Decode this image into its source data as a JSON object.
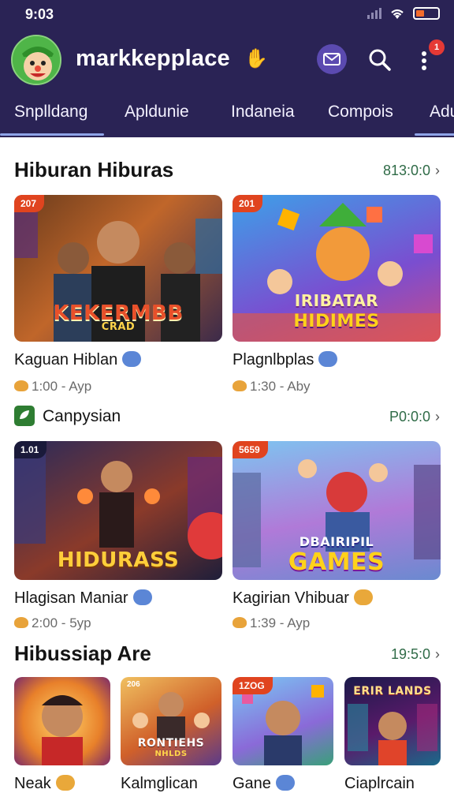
{
  "status": {
    "time": "9:03"
  },
  "app": {
    "title": "markkepplace",
    "notification_count": "1"
  },
  "tabs": [
    "Snplldang",
    "Apldunie",
    "Indaneia",
    "Compois",
    "Adu"
  ],
  "sections": [
    {
      "title": "Hiburan Hiburas",
      "link": "813:0:0",
      "cards": [
        {
          "tag": "207",
          "art_title": "KEKERMBB",
          "art_sub": "CRAD",
          "name": "Kaguan Hiblan",
          "badge": "blue",
          "meta": "1:00 - Ayp"
        },
        {
          "tag": "201",
          "art_title": "IRIBATAR",
          "art_sub": "HIDIMES",
          "name": "Plagnlbplas",
          "badge": "blue",
          "meta": "1:30 - Aby"
        }
      ]
    },
    {
      "title": "Canpysian",
      "link": "P0:0:0",
      "cards": [
        {
          "tag": "1.01",
          "art_title": "HIDURASS",
          "art_sub": "",
          "name": "Hlagisan Maniar",
          "badge": "blue",
          "meta": "2:00 - 5yp"
        },
        {
          "tag": "5659",
          "art_title": "DBAIRIPIL",
          "art_sub": "GAMES",
          "name": "Kagirian Vhibuar",
          "badge": "gold",
          "meta": "1:39 - Ayp"
        }
      ]
    },
    {
      "title": "Hibussiap Are",
      "link": "19:5:0",
      "cards": [
        {
          "tag": "",
          "art_title": "",
          "art_sub": "",
          "name": "Neak",
          "badge": "gold"
        },
        {
          "tag": "206",
          "art_title": "RONTIEHS",
          "art_sub": "NHLDS",
          "name": "Kalmglican",
          "badge": ""
        },
        {
          "tag": "1ZOG",
          "art_title": "",
          "art_sub": "",
          "name": "Gane",
          "badge": "blue"
        },
        {
          "tag": "",
          "art_title": "ERIR LANDS",
          "art_sub": "",
          "name": "Ciaplrcain",
          "badge": ""
        }
      ]
    }
  ],
  "colors": {
    "header": "#2a2355",
    "accent": "#5b4ab0",
    "link": "#2f6b47",
    "tag": "#e0441f"
  }
}
